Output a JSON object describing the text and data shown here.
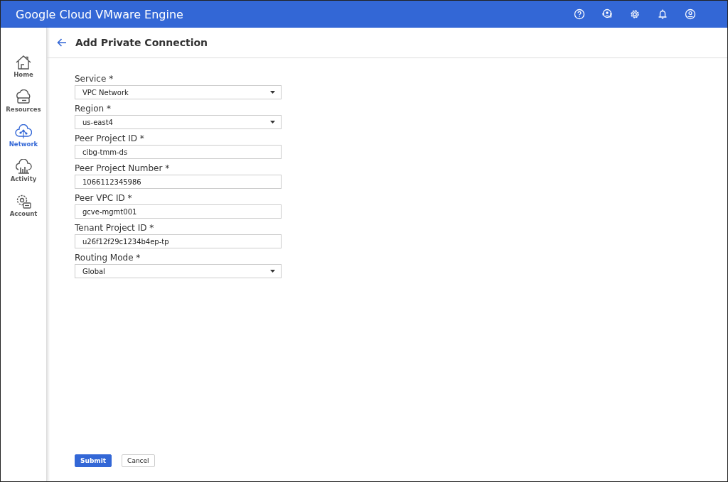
{
  "app_bar": {
    "title": "Google Cloud VMware Engine"
  },
  "sidebar": {
    "items": [
      {
        "label": "Home",
        "kind": "home",
        "selected": false
      },
      {
        "label": "Resources",
        "kind": "resources",
        "selected": false
      },
      {
        "label": "Network",
        "kind": "network",
        "selected": true
      },
      {
        "label": "Activity",
        "kind": "activity",
        "selected": false
      },
      {
        "label": "Account",
        "kind": "account",
        "selected": false
      }
    ]
  },
  "page": {
    "title": "Add Private Connection"
  },
  "form": {
    "fields": [
      {
        "label": "Service *",
        "kind": "select",
        "value": "VPC Network"
      },
      {
        "label": "Region *",
        "kind": "select",
        "value": "us-east4"
      },
      {
        "label": "Peer Project ID *",
        "kind": "text",
        "value": "cibg-tmm-ds"
      },
      {
        "label": "Peer Project Number *",
        "kind": "text",
        "value": "1066112345986"
      },
      {
        "label": "Peer VPC ID *",
        "kind": "text",
        "value": "gcve-mgmt001"
      },
      {
        "label": "Tenant Project ID *",
        "kind": "text",
        "value": "u26f12f29c1234b4ep-tp"
      },
      {
        "label": "Routing Mode *",
        "kind": "select",
        "value": "Global"
      }
    ]
  },
  "buttons": [
    {
      "label": "Submit",
      "kind": "primary"
    },
    {
      "label": "Cancel",
      "kind": "secondary"
    }
  ]
}
